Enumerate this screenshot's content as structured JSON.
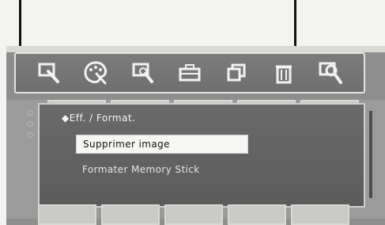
{
  "menu": {
    "title": "◆Eff. / Format.",
    "options": [
      {
        "label": "Supprimer image",
        "selected": true
      },
      {
        "label": "Formater Memory Stick",
        "selected": false
      }
    ]
  },
  "toolbar_icons": [
    "magnify-select-icon",
    "palette-icon",
    "search-icon",
    "toolbox-icon",
    "copy-icon",
    "trash-icon",
    "zoom-in-icon"
  ],
  "colors": {
    "menu_bg": "#6f6f6f",
    "selected_bg": "#f6f6f4",
    "text": "#f4f4f4"
  }
}
